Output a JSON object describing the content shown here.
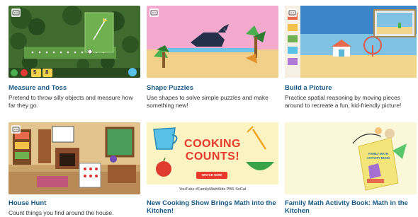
{
  "cards": [
    {
      "title": "Measure and Toss",
      "description": "Pretend to throw silly objects and measure how far they go.",
      "thumb_counts": [
        "5",
        "8"
      ],
      "icon": "game-icon"
    },
    {
      "title": "Shape Puzzles",
      "description": "Use shapes to solve simple puzzles and make something new!",
      "icon": "game-icon"
    },
    {
      "title": "Build a Picture",
      "description": "Practice spatial reasoning by moving pieces around to recreate a fun, kid-friendly picture!",
      "icon": "game-icon"
    },
    {
      "title": "House Hunt",
      "description": "Count things you find around the house.",
      "icon": "game-icon"
    },
    {
      "title": "New Cooking Show Brings Math into the Kitchen!",
      "banner_line1": "COOKING",
      "banner_line2": "COUNTS!",
      "button_label": "WATCH NOW",
      "footer": "YouTube  #FamilyMathKids  PBS SoCal"
    },
    {
      "title": "Family Math Activity Book: Math in the Kitchen",
      "book_title": "FAMILY MATH ACTIVITY BOOK"
    }
  ],
  "colors": {
    "title": "#165a86",
    "shape_bg": "#f4a9cf",
    "sand": "#f3d08a",
    "cooking_bg": "#fbf3c2",
    "cooking_red": "#e8392c"
  }
}
